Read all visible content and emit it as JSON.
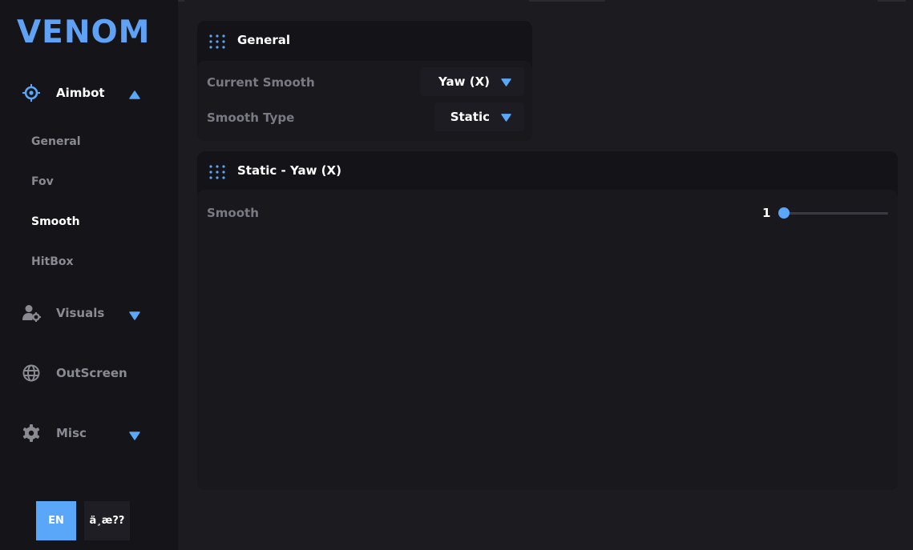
{
  "app": {
    "logo": "VENOM",
    "accent": "#5aa6f8"
  },
  "sidebar": {
    "groups": [
      {
        "label": "Aimbot",
        "icon": "crosshair-icon",
        "expanded": true,
        "items": [
          "General",
          "Fov",
          "Smooth",
          "HitBox"
        ],
        "active_item": "Smooth"
      },
      {
        "label": "Visuals",
        "icon": "user-gear-icon",
        "expanded": false
      },
      {
        "label": "OutScreen",
        "icon": "globe-icon",
        "expanded": false
      },
      {
        "label": "Misc",
        "icon": "gear-icon",
        "expanded": false
      }
    ],
    "languages": [
      "EN",
      "ä¸­æ??"
    ]
  },
  "general_panel": {
    "title": "General",
    "rows": [
      {
        "label": "Current Smooth",
        "value": "Yaw (X)"
      },
      {
        "label": "Smooth Type",
        "value": "Static"
      }
    ]
  },
  "smooth_panel": {
    "title": "Static - Yaw (X)",
    "slider": {
      "label": "Smooth",
      "value": "1"
    }
  }
}
